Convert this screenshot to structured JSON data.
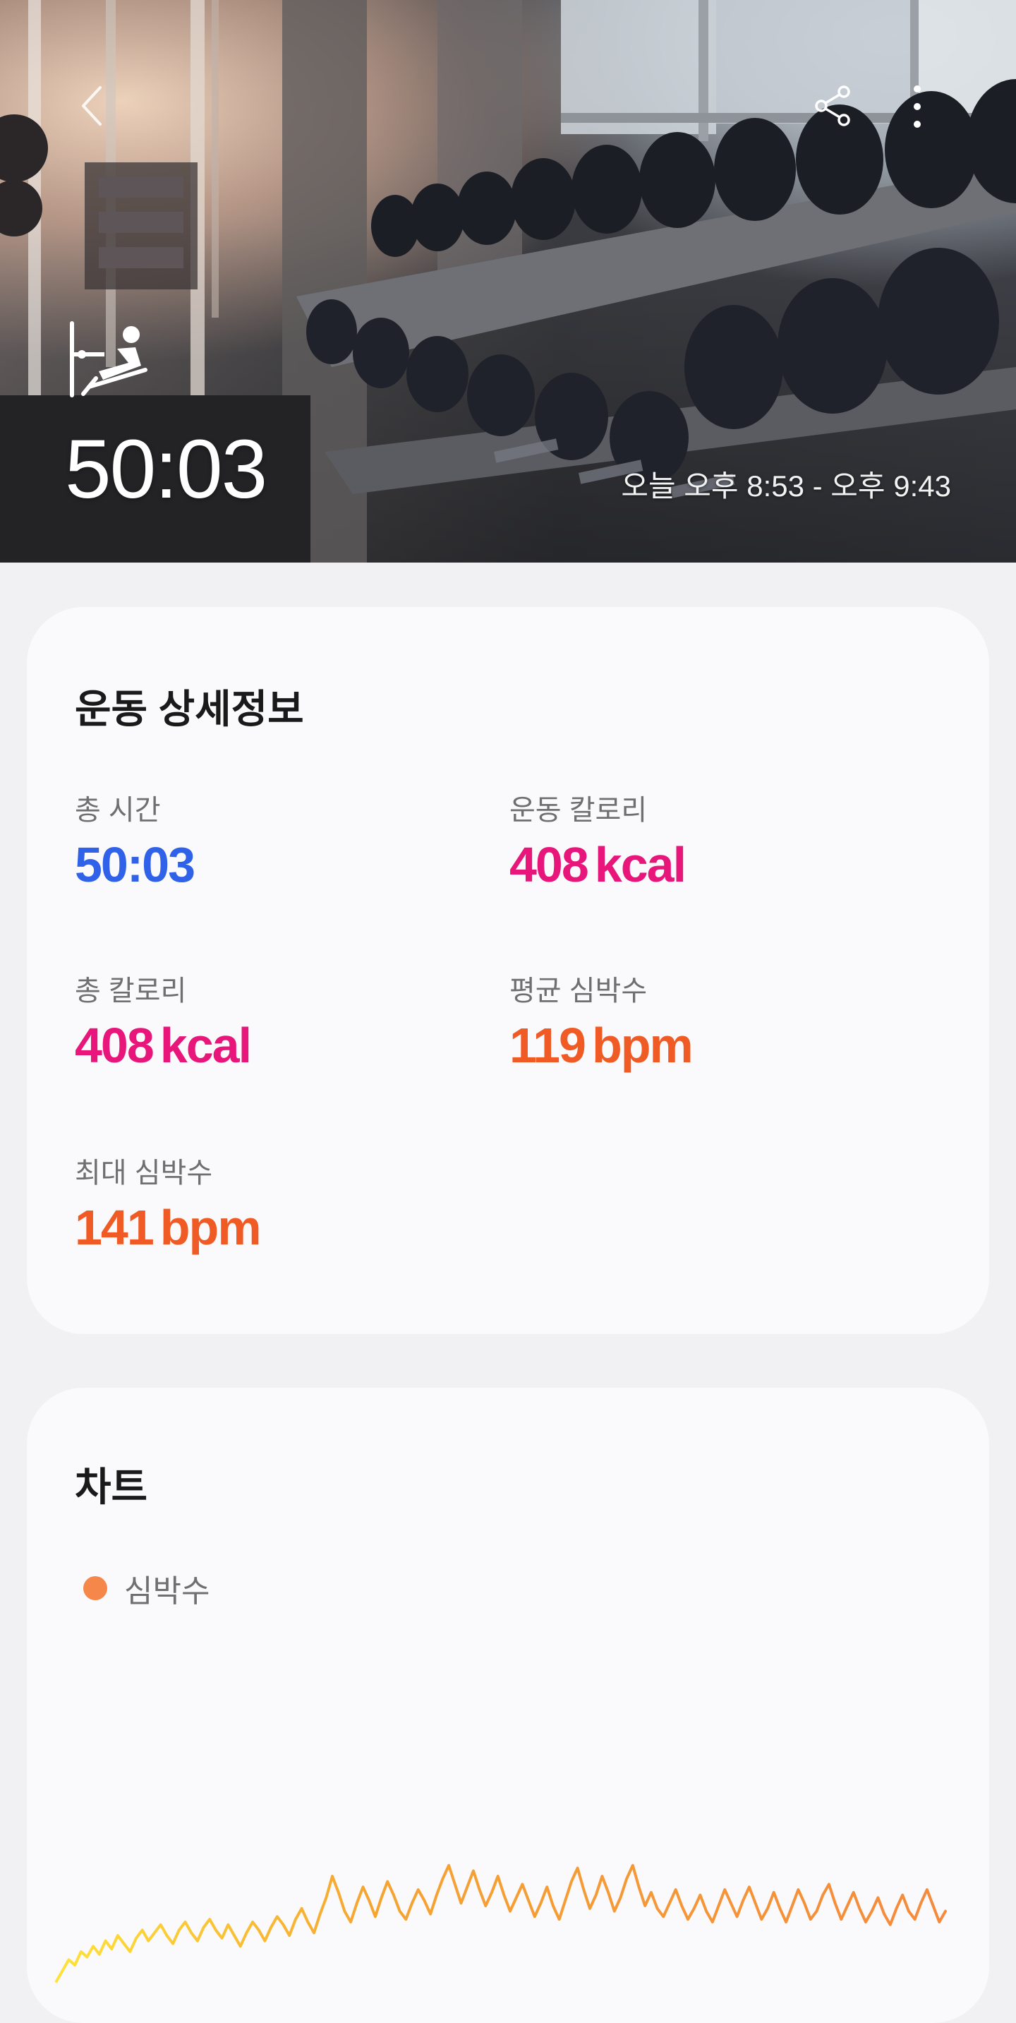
{
  "header": {
    "back_icon": "chevron-left-icon",
    "share_icon": "share-icon",
    "more_icon": "more-vertical-icon",
    "activity_icon": "rowing-machine-icon",
    "duration": "50:03",
    "time_range": "오늘 오후 8:53 - 오후 9:43"
  },
  "details": {
    "title": "운동 상세정보",
    "metrics": [
      {
        "label": "총 시간",
        "value": "50:03",
        "unit": "",
        "color": "#2f62e8"
      },
      {
        "label": "운동 칼로리",
        "value": "408",
        "unit": "kcal",
        "color": "#e8157a"
      },
      {
        "label": "총 칼로리",
        "value": "408",
        "unit": "kcal",
        "color": "#e8157a"
      },
      {
        "label": "평균 심박수",
        "value": "119",
        "unit": "bpm",
        "color": "#f05a24"
      },
      {
        "label": "최대 심박수",
        "value": "141",
        "unit": "bpm",
        "color": "#f05a24"
      }
    ]
  },
  "chart_section": {
    "title": "차트",
    "legend_label": "심박수",
    "legend_color": "#f5874a"
  },
  "chart_data": {
    "type": "line",
    "series": [
      {
        "name": "심박수",
        "values": [
          95,
          99,
          103,
          101,
          106,
          104,
          108,
          105,
          110,
          107,
          112,
          109,
          106,
          111,
          114,
          110,
          113,
          116,
          112,
          109,
          114,
          117,
          113,
          110,
          115,
          118,
          114,
          111,
          116,
          112,
          108,
          113,
          117,
          114,
          110,
          115,
          119,
          116,
          112,
          118,
          122,
          117,
          113,
          120,
          126,
          134,
          128,
          121,
          117,
          124,
          130,
          125,
          119,
          126,
          132,
          127,
          121,
          118,
          124,
          129,
          125,
          120,
          127,
          133,
          138,
          131,
          124,
          130,
          136,
          129,
          123,
          128,
          134,
          127,
          121,
          126,
          131,
          125,
          119,
          124,
          130,
          123,
          118,
          125,
          132,
          137,
          129,
          122,
          127,
          134,
          128,
          121,
          126,
          133,
          138,
          130,
          123,
          128,
          122,
          119,
          124,
          129,
          123,
          118,
          122,
          127,
          121,
          117,
          123,
          129,
          124,
          119,
          125,
          130,
          124,
          118,
          122,
          128,
          122,
          117,
          123,
          129,
          124,
          118,
          121,
          127,
          131,
          124,
          118,
          123,
          128,
          122,
          117,
          121,
          126,
          120,
          116,
          122,
          127,
          121,
          118,
          124,
          129,
          123,
          117,
          121
        ]
      }
    ],
    "colors": [
      "#ffe23a",
      "#f5a532",
      "#f58a3c"
    ],
    "grid": false
  }
}
